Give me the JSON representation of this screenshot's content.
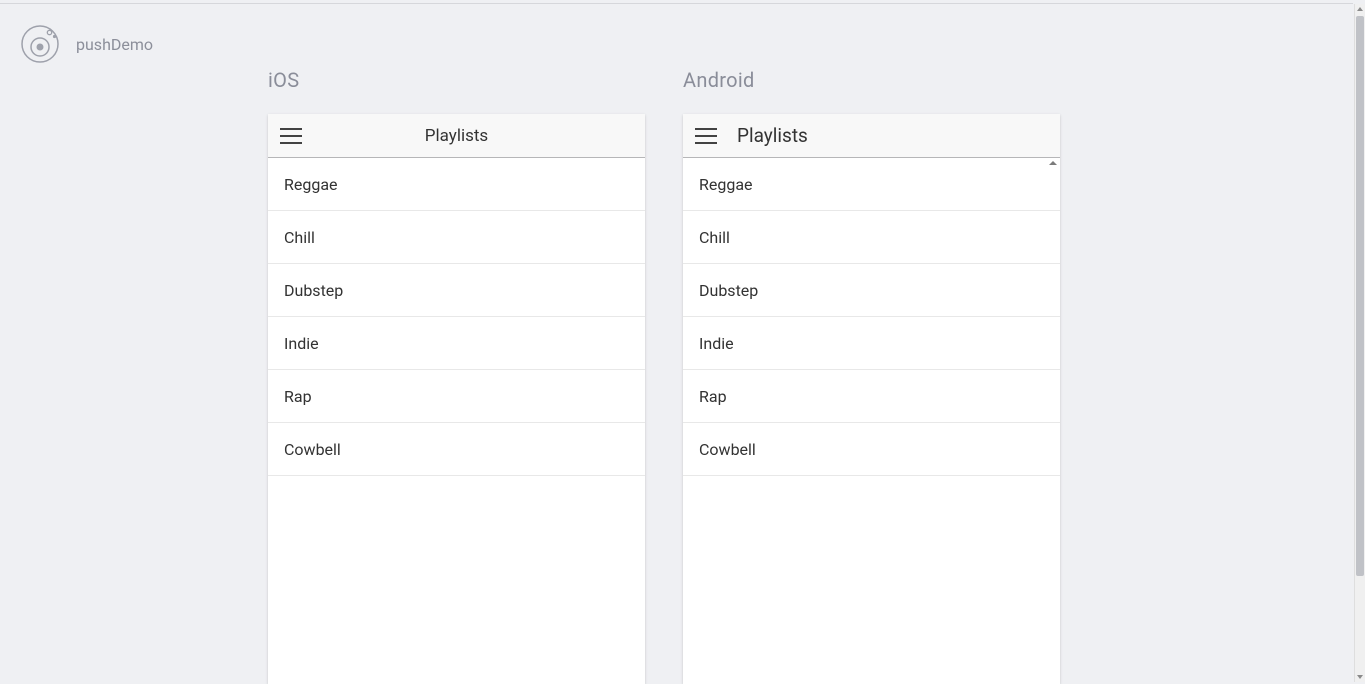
{
  "app": {
    "name": "pushDemo"
  },
  "columns": [
    {
      "id": "ios",
      "label": "iOS",
      "toolbar_title": "Playlists",
      "title_style": "center",
      "items": [
        "Reggae",
        "Chill",
        "Dubstep",
        "Indie",
        "Rap",
        "Cowbell"
      ]
    },
    {
      "id": "android",
      "label": "Android",
      "toolbar_title": "Playlists",
      "title_style": "left",
      "items": [
        "Reggae",
        "Chill",
        "Dubstep",
        "Indie",
        "Rap",
        "Cowbell"
      ]
    }
  ]
}
